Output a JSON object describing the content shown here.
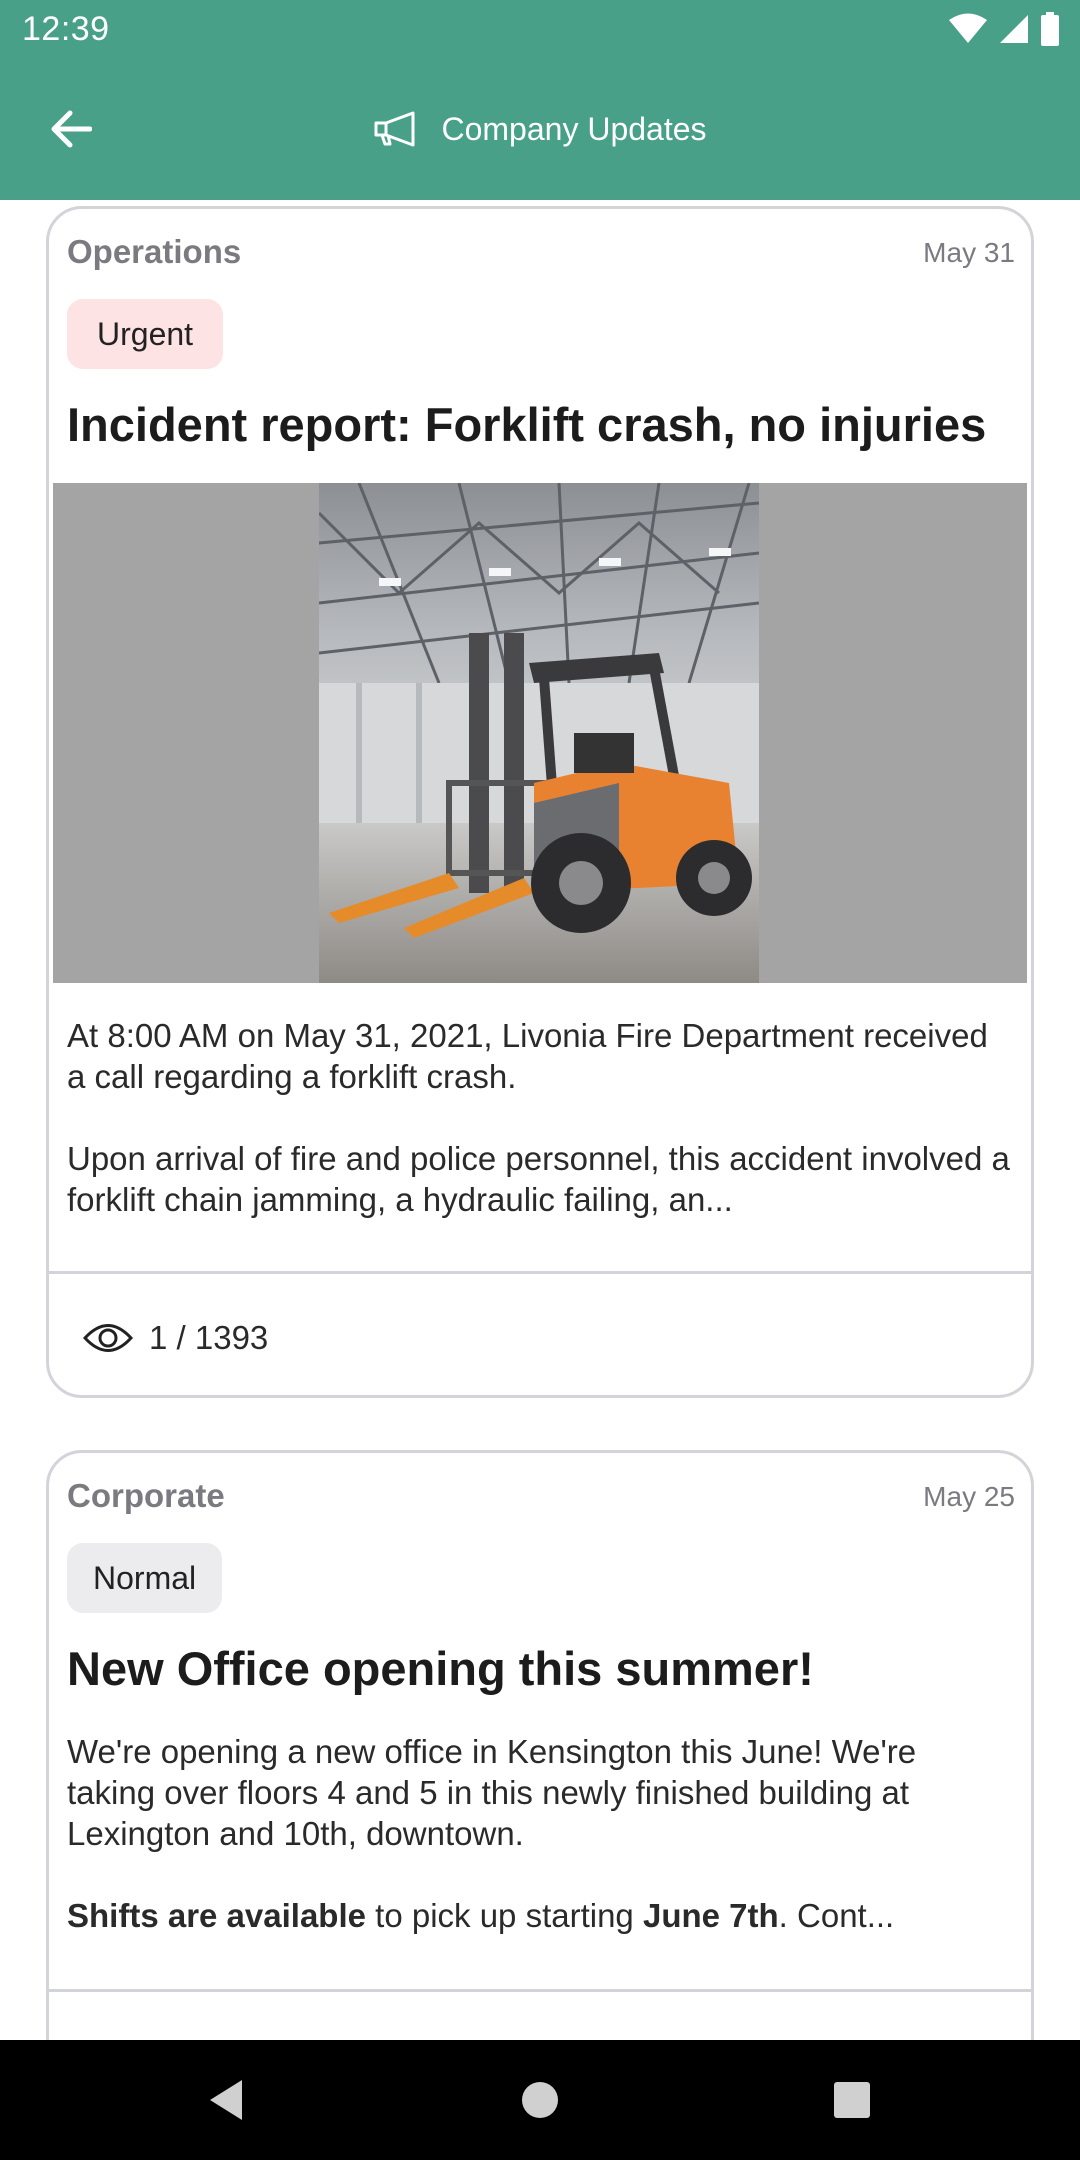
{
  "status_bar": {
    "time": "12:39"
  },
  "app_bar": {
    "title": "Company Updates",
    "back_icon": "arrow-left-icon",
    "title_icon": "megaphone-icon"
  },
  "posts": [
    {
      "category": "Operations",
      "date": "May 31",
      "priority": "Urgent",
      "title": "Incident report: Forklift crash, no injuries",
      "body": [
        "At 8:00 AM on May 31, 2021, Livonia Fire Department received a call regarding a forklift crash.",
        "Upon arrival of fire and police personnel, this accident involved a forklift chain jamming, a hydraulic failing, an..."
      ],
      "views": "1 / 1393"
    },
    {
      "category": "Corporate",
      "date": "May 25",
      "priority": "Normal",
      "title": "New Office opening this summer!",
      "body_p1": "We're opening a new office in Kensington this June! We're taking over floors 4 and 5 in this newly finished building at Lexington and 10th, downtown.",
      "body_p2": {
        "bold1": "Shifts are available",
        "text1": " to pick up starting ",
        "bold2": "June 7th",
        "text2": ". Cont..."
      }
    }
  ],
  "colors": {
    "accent": "#48a089",
    "urgent_badge": "#fde3e3",
    "normal_badge": "#ececee"
  }
}
